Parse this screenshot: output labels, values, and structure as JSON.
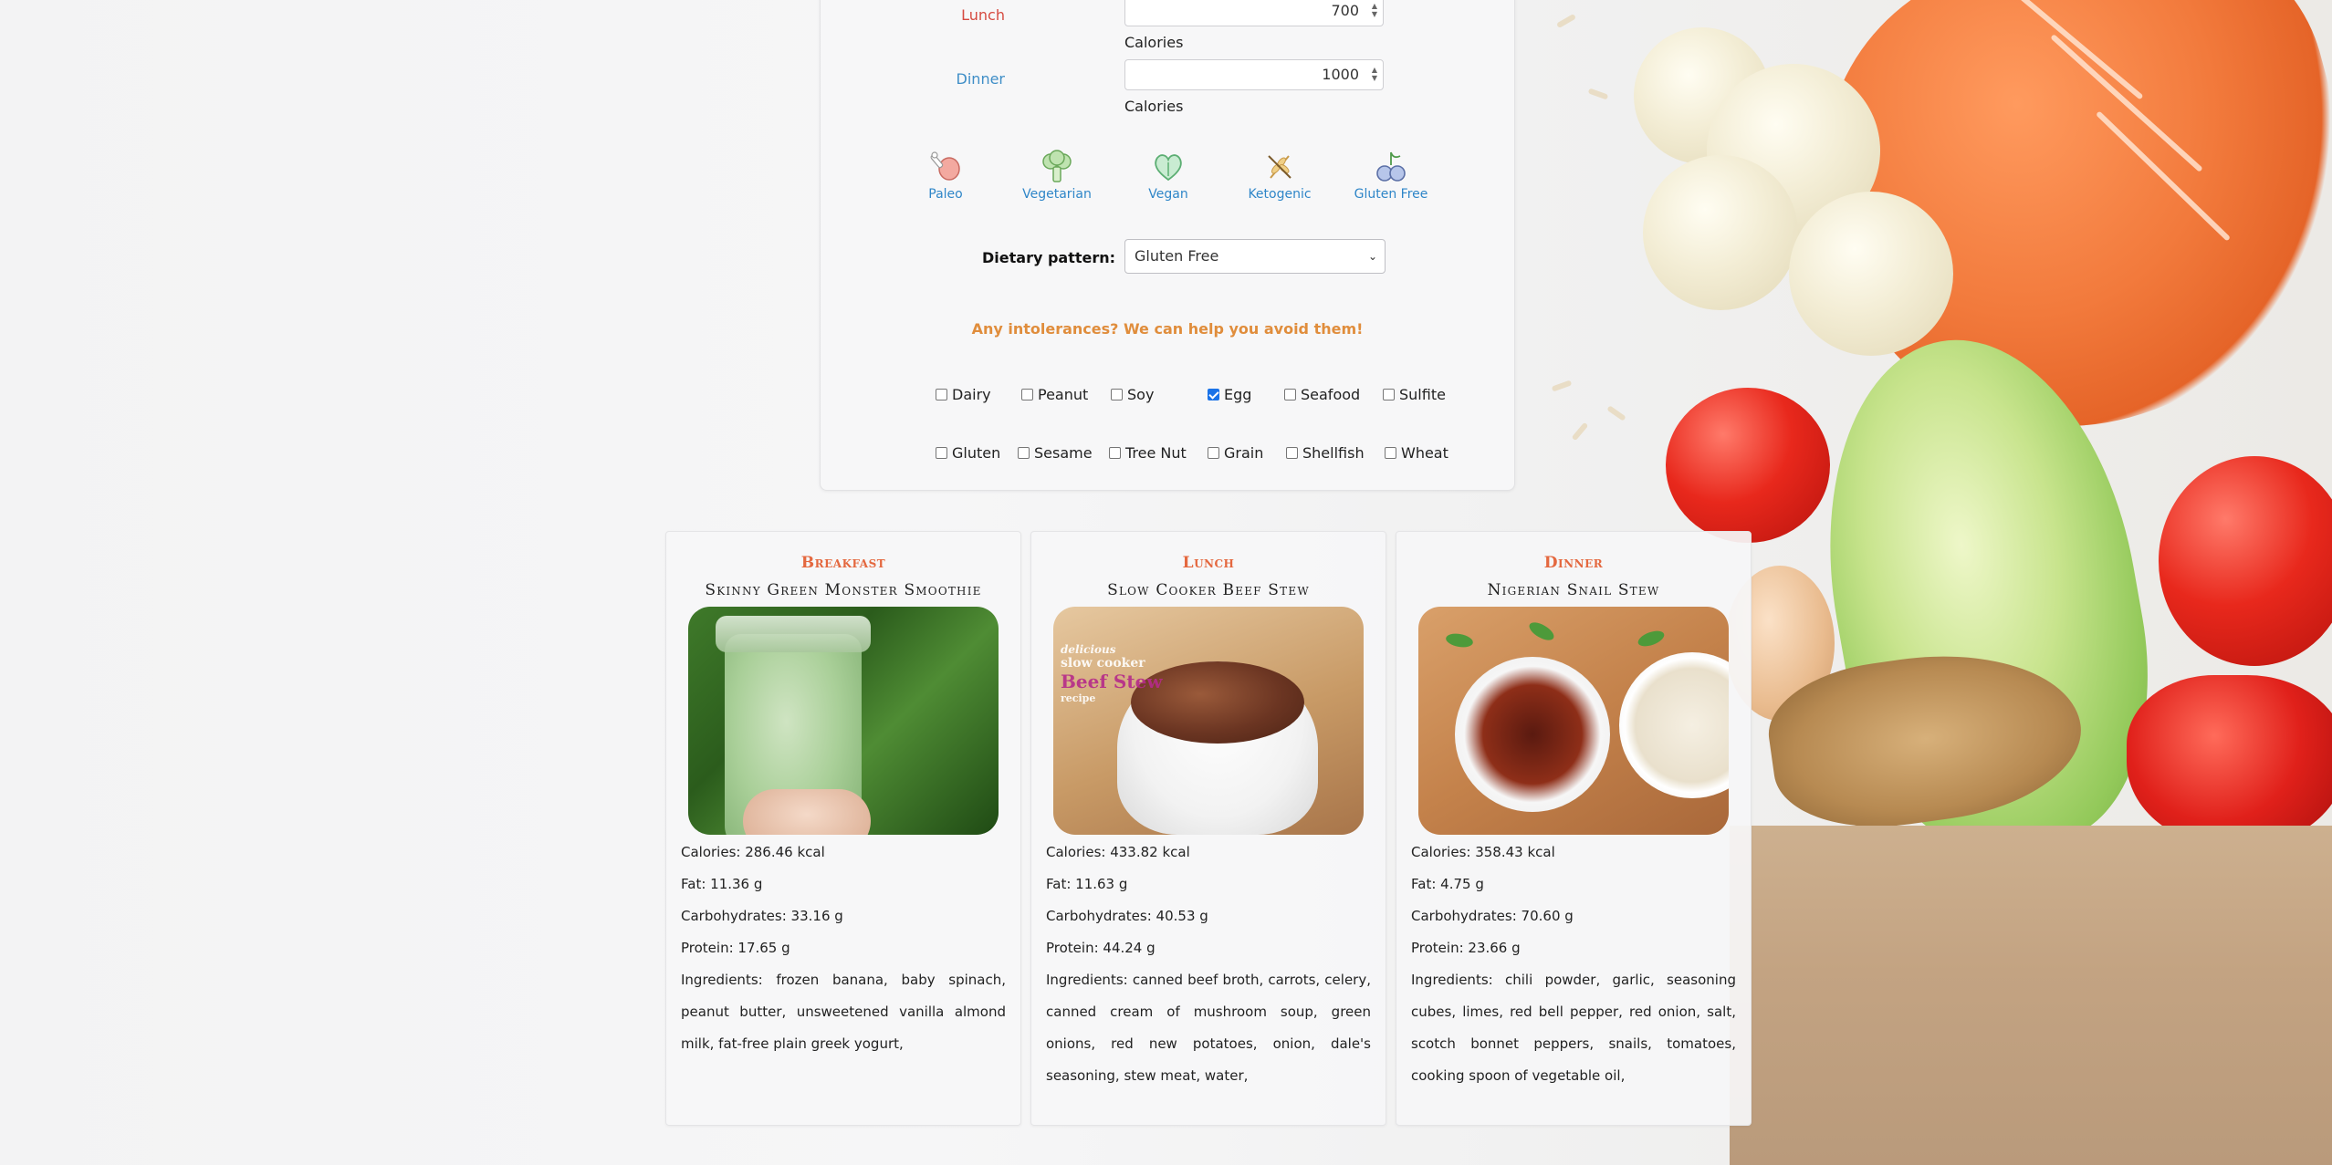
{
  "form": {
    "lunch": {
      "label": "Lunch",
      "value": "700",
      "unit": "Calories"
    },
    "dinner": {
      "label": "Dinner",
      "value": "1000",
      "unit": "Calories"
    },
    "diets": [
      {
        "label": "Paleo",
        "icon": "drumstick-icon"
      },
      {
        "label": "Vegetarian",
        "icon": "broccoli-icon"
      },
      {
        "label": "Vegan",
        "icon": "heart-leaf-icon"
      },
      {
        "label": "Ketogenic",
        "icon": "no-wheat-icon"
      },
      {
        "label": "Gluten Free",
        "icon": "grapes-icon"
      }
    ],
    "pattern_label": "Dietary pattern:",
    "pattern_value": "Gluten Free",
    "intolerance_title": "Any intolerances? We can help you avoid them!",
    "intolerances": [
      {
        "label": "Dairy",
        "checked": false
      },
      {
        "label": "Peanut",
        "checked": false
      },
      {
        "label": "Soy",
        "checked": false
      },
      {
        "label": "Egg",
        "checked": true
      },
      {
        "label": "Seafood",
        "checked": false
      },
      {
        "label": "Sulfite",
        "checked": false
      },
      {
        "label": "Gluten",
        "checked": false
      },
      {
        "label": "Sesame",
        "checked": false
      },
      {
        "label": "Tree Nut",
        "checked": false
      },
      {
        "label": "Grain",
        "checked": false
      },
      {
        "label": "Shellfish",
        "checked": false
      },
      {
        "label": "Wheat",
        "checked": false
      }
    ],
    "accent_colors": {
      "lunch": "#d64b41",
      "dinner": "#3f8ec7",
      "diet": "#2f86c8",
      "intolerance": "#e08d3c",
      "meal_type": "#e4683f"
    }
  },
  "meals": [
    {
      "type": "Breakfast",
      "title": "Skinny Green Monster Smoothie",
      "calories": "Calories: 286.46 kcal",
      "fat": "Fat: 11.36 g",
      "carbs": "Carbohydrates: 33.16 g",
      "protein": "Protein: 17.65 g",
      "ingredients": "Ingredients: frozen banana, baby spinach, peanut butter, unsweetened vanilla almond milk, fat-free plain greek yogurt,"
    },
    {
      "type": "Lunch",
      "title": "Slow Cooker Beef Stew",
      "calories": "Calories: 433.82 kcal",
      "fat": "Fat: 11.63 g",
      "carbs": "Carbohydrates: 40.53 g",
      "protein": "Protein: 44.24 g",
      "ingredients": "Ingredients: canned beef broth, carrots, celery, canned cream of mushroom soup, green onions, red new potatoes, onion, dale's seasoning, stew meat, water,",
      "image_overlay": [
        "delicious",
        "slow cooker",
        "Beef Stew",
        "recipe"
      ]
    },
    {
      "type": "Dinner",
      "title": "Nigerian Snail Stew",
      "calories": "Calories: 358.43 kcal",
      "fat": "Fat: 4.75 g",
      "carbs": "Carbohydrates: 70.60 g",
      "protein": "Protein: 23.66 g",
      "ingredients": "Ingredients: chili powder, garlic, seasoning cubes, limes, red bell pepper, red onion, salt, scotch bonnet peppers, snails, tomatoes, cooking spoon of vegetable oil,"
    }
  ]
}
